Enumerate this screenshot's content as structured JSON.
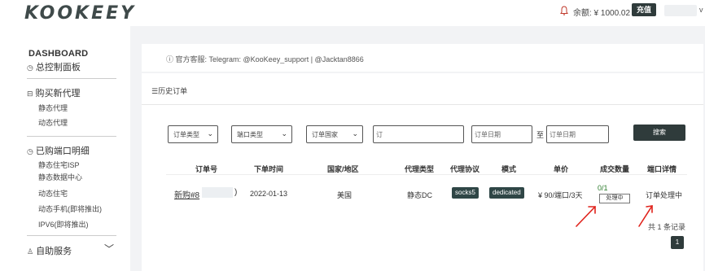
{
  "topbar": {
    "logo": "KOOKEEY",
    "balance": "余额: ¥ 1000.02",
    "recharge_label": "充值",
    "user_initial": "v"
  },
  "sidebar": {
    "dashboard_title": "DASHBOARD",
    "control_panel": "总控制面板",
    "buy_new_proxy": "购买新代理",
    "static_proxy": "静态代理",
    "dynamic_proxy": "动态代理",
    "purchased_ports": "已购端口明细",
    "static_residential_isp": "静态住宅ISP",
    "static_datacenter": "静态数据中心",
    "dynamic_residential": "动态住宅",
    "dynamic_mobile": "动态手机(即将推出)",
    "ipv6": "IPV6(即将推出)",
    "self_service": "自助服务"
  },
  "banner": {
    "support_text": "官方客服: Telegram: @KooKeey_support | @Jacktan8866"
  },
  "main": {
    "section_title": "历史订单",
    "filters": {
      "order_type": "订单类型",
      "port_type": "端口类型",
      "order_country": "订单国家",
      "order_no_input": "订",
      "date_start_placeholder": "订单日期",
      "to_label": "至",
      "date_end_placeholder": "订单日期",
      "search_label": "搜索"
    },
    "table": {
      "headers": [
        "订单号",
        "下单时间",
        "国家/地区",
        "代理类型",
        "代理协议",
        "模式",
        "单价",
        "成交数量",
        "端口详情"
      ],
      "row": {
        "order_no": "新购#8",
        "order_no_tail": ")",
        "order_time": "2022-01-13",
        "country": "美国",
        "proxy_type": "静态DC",
        "protocol": "socks5",
        "mode": "dedicated",
        "price": "¥ 90/端口/3天",
        "quantity": "0/1",
        "quantity_status": "处理中",
        "port_detail": "订单处理中"
      }
    },
    "total_records": "共 1 条记录",
    "current_page": "1"
  },
  "colors": {
    "dark_accent": "#2f3b3b",
    "tag_bg": "#2f4646",
    "annotation_arrow": "#e0231c",
    "quantity_green": "#2a7a2a"
  }
}
